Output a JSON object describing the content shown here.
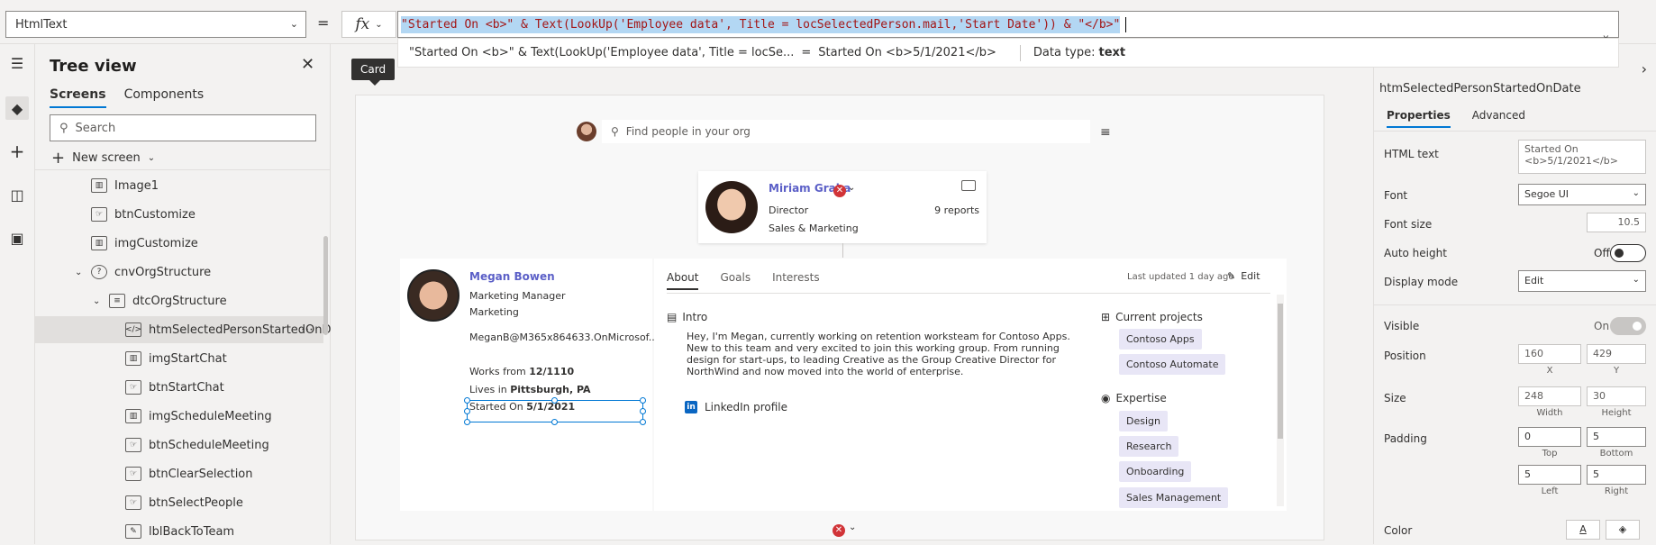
{
  "formula_bar": {
    "property": "HtmlText",
    "equals": "=",
    "fx": "fx",
    "formula": "\"Started On <b>\" & Text(LookUp('Employee data', Title = locSelectedPerson.mail,'Start Date')) & \"</b>\"",
    "preview_expr": "\"Started On <b>\" & Text(LookUp('Employee data', Title = locSe...",
    "preview_eq": "=",
    "preview_result": "Started On <b>5/1/2021</b>",
    "datatype_label": "Data type:",
    "datatype_value": "text"
  },
  "tree": {
    "title": "Tree view",
    "tabs": [
      "Screens",
      "Components"
    ],
    "search_placeholder": "Search",
    "new_screen": "New screen",
    "items": [
      {
        "label": "Image1",
        "icon": "image-icon",
        "indent": 0
      },
      {
        "label": "btnCustomize",
        "icon": "button-icon",
        "indent": 0
      },
      {
        "label": "imgCustomize",
        "icon": "image-icon",
        "indent": 0
      },
      {
        "label": "cnvOrgStructure",
        "icon": "container-icon",
        "indent": 0
      },
      {
        "label": "dtcOrgStructure",
        "icon": "datacard-icon",
        "indent": 1
      },
      {
        "label": "htmSelectedPersonStartedOnDat",
        "icon": "html-icon",
        "indent": 2
      },
      {
        "label": "imgStartChat",
        "icon": "image-icon",
        "indent": 2
      },
      {
        "label": "btnStartChat",
        "icon": "button-icon",
        "indent": 2
      },
      {
        "label": "imgScheduleMeeting",
        "icon": "image-icon",
        "indent": 2
      },
      {
        "label": "btnScheduleMeeting",
        "icon": "button-icon",
        "indent": 2
      },
      {
        "label": "btnClearSelection",
        "icon": "button-icon",
        "indent": 2
      },
      {
        "label": "btnSelectPeople",
        "icon": "button-icon",
        "indent": 2
      },
      {
        "label": "lblBackToTeam",
        "icon": "label-icon",
        "indent": 2
      }
    ]
  },
  "canvas": {
    "tooltip": "Card",
    "search_placeholder": "Find people in your org",
    "manager": {
      "name": "Miriam Graha",
      "title": "Director",
      "department": "Sales & Marketing",
      "reports": "9 reports"
    },
    "person": {
      "name": "Megan Bowen",
      "title": "Marketing Manager",
      "department": "Marketing",
      "email": "MeganB@M365x864633.OnMicrosof...",
      "works_from_label": "Works from",
      "works_from": "12/1110",
      "lives_in_label": "Lives in",
      "lives_in": "Pittsburgh, PA",
      "started_label": "Started On",
      "started": "5/1/2021"
    },
    "detail": {
      "tabs": [
        "About",
        "Goals",
        "Interests"
      ],
      "updated": "Last updated 1 day ago",
      "edit": "Edit",
      "intro_heading": "Intro",
      "intro": "Hey, I'm Megan, currently working on retention worksteam for Contoso Apps. New to this team and very excited to join this working group. From running design for start-ups, to leading Creative as the Group Creative Director for NorthWind and now moved into the world of enterprise.",
      "linkedin": "LinkedIn profile",
      "projects_heading": "Current projects",
      "projects": [
        "Contoso Apps",
        "Contoso Automate"
      ],
      "expertise_heading": "Expertise",
      "expertise": [
        "Design",
        "Research",
        "Onboarding",
        "Sales Management"
      ]
    }
  },
  "properties": {
    "control_name": "htmSelectedPersonStartedOnDate",
    "tabs": [
      "Properties",
      "Advanced"
    ],
    "html_text_label": "HTML text",
    "html_text_value": "Started On <b>5/1/2021</b>",
    "font_label": "Font",
    "font_value": "Segoe UI",
    "font_size_label": "Font size",
    "font_size_value": "10.5",
    "auto_height_label": "Auto height",
    "auto_height_state": "Off",
    "display_mode_label": "Display mode",
    "display_mode_value": "Edit",
    "visible_label": "Visible",
    "visible_state": "On",
    "position_label": "Position",
    "pos_x": "160",
    "pos_y": "429",
    "x_label": "X",
    "y_label": "Y",
    "size_label": "Size",
    "width": "248",
    "height": "30",
    "width_label": "Width",
    "height_label": "Height",
    "padding_label": "Padding",
    "pad_top": "0",
    "pad_bottom": "5",
    "pad_left": "5",
    "pad_right": "5",
    "top_label": "Top",
    "bottom_label": "Bottom",
    "left_label": "Left",
    "right_label": "Right",
    "color_label": "Color",
    "color_btn": "A"
  },
  "colors": {
    "accent": "#0078d4",
    "name_link": "#5b5fc7",
    "error": "#d13438"
  }
}
